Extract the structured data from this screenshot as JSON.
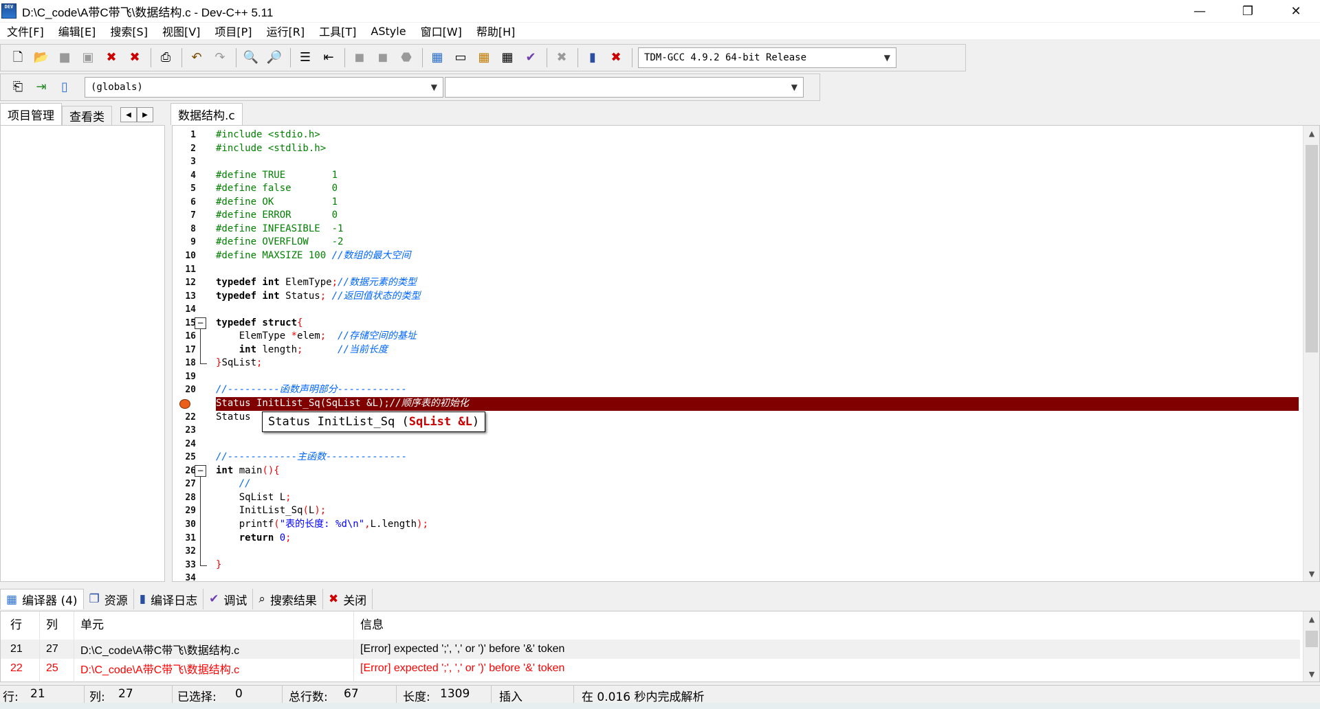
{
  "window": {
    "title": "D:\\C_code\\A带C带飞\\数据结构.c - Dev-C++ 5.11",
    "app_icon_label": "DEV",
    "minimize": "—",
    "restore": "❐",
    "close": "✕"
  },
  "menu": [
    "文件[F]",
    "编辑[E]",
    "搜索[S]",
    "视图[V]",
    "项目[P]",
    "运行[R]",
    "工具[T]",
    "AStyle",
    "窗口[W]",
    "帮助[H]"
  ],
  "toolbar": {
    "compiler_select": "TDM-GCC 4.9.2 64-bit Release",
    "scope_select": "(globals)",
    "function_select": ""
  },
  "left_panel": {
    "tabs": [
      "项目管理",
      "查看类"
    ],
    "nav_prev": "◀",
    "nav_next": "▶"
  },
  "editor": {
    "tab_label": "数据结构.c",
    "error_line": 21,
    "cursor": {
      "line": 21,
      "col": 27
    },
    "lines": [
      {
        "n": "1",
        "t": [
          [
            "pp",
            "#include <stdio.h>"
          ]
        ]
      },
      {
        "n": "2",
        "t": [
          [
            "pp",
            "#include <stdlib.h>"
          ]
        ]
      },
      {
        "n": "3",
        "t": []
      },
      {
        "n": "4",
        "t": [
          [
            "pp",
            "#define TRUE        1"
          ]
        ]
      },
      {
        "n": "5",
        "t": [
          [
            "pp",
            "#define false       0"
          ]
        ]
      },
      {
        "n": "6",
        "t": [
          [
            "pp",
            "#define OK          1"
          ]
        ]
      },
      {
        "n": "7",
        "t": [
          [
            "pp",
            "#define ERROR       0"
          ]
        ]
      },
      {
        "n": "8",
        "t": [
          [
            "pp",
            "#define INFEASIBLE  -1"
          ]
        ]
      },
      {
        "n": "9",
        "t": [
          [
            "pp",
            "#define OVERFLOW    -2"
          ]
        ]
      },
      {
        "n": "10",
        "t": [
          [
            "pp",
            "#define MAXSIZE 100 "
          ],
          [
            "cm",
            "//数组的最大空间"
          ]
        ]
      },
      {
        "n": "11",
        "t": []
      },
      {
        "n": "12",
        "t": [
          [
            "kw",
            "typedef int "
          ],
          [
            "",
            "ElemType"
          ],
          [
            "sym",
            ";"
          ],
          [
            "cm",
            "//数据元素的类型"
          ]
        ]
      },
      {
        "n": "13",
        "t": [
          [
            "kw",
            "typedef int "
          ],
          [
            "",
            "Status"
          ],
          [
            "sym",
            "; "
          ],
          [
            "cm",
            "//返回值状态的类型"
          ]
        ]
      },
      {
        "n": "14",
        "t": []
      },
      {
        "n": "15",
        "t": [
          [
            "kw",
            "typedef struct"
          ],
          [
            "sym",
            "{"
          ]
        ]
      },
      {
        "n": "16",
        "t": [
          [
            "",
            "    ElemType "
          ],
          [
            "sym",
            "*"
          ],
          [
            "",
            "elem"
          ],
          [
            "sym",
            ";  "
          ],
          [
            "cm",
            "//存储空间的基址"
          ]
        ]
      },
      {
        "n": "17",
        "t": [
          [
            "kw",
            "    int "
          ],
          [
            "",
            "length"
          ],
          [
            "sym",
            ";      "
          ],
          [
            "cm",
            "//当前长度"
          ]
        ]
      },
      {
        "n": "18",
        "t": [
          [
            "sym",
            "}"
          ],
          [
            "",
            "SqList"
          ],
          [
            "sym",
            ";"
          ]
        ]
      },
      {
        "n": "19",
        "t": []
      },
      {
        "n": "20",
        "t": [
          [
            "cm",
            "//---------函数声明部分------------"
          ]
        ]
      },
      {
        "n": "21",
        "t": [
          [
            "",
            "Status InitList_Sq(SqList &L);"
          ],
          [
            "cm",
            "//顺序表的初始化"
          ]
        ]
      },
      {
        "n": "22",
        "t": [
          [
            "",
            "Status                              "
          ],
          [
            "sym",
            ";"
          ]
        ]
      },
      {
        "n": "23",
        "t": []
      },
      {
        "n": "24",
        "t": []
      },
      {
        "n": "25",
        "t": [
          [
            "cm",
            "//------------主函数--------------"
          ]
        ]
      },
      {
        "n": "26",
        "t": [
          [
            "kw",
            "int "
          ],
          [
            "",
            "main"
          ],
          [
            "sym",
            "(){"
          ]
        ]
      },
      {
        "n": "27",
        "t": [
          [
            "cm",
            "    //"
          ]
        ]
      },
      {
        "n": "28",
        "t": [
          [
            "",
            "    SqList L"
          ],
          [
            "sym",
            ";"
          ]
        ]
      },
      {
        "n": "29",
        "t": [
          [
            "",
            "    InitList_Sq"
          ],
          [
            "sym",
            "("
          ],
          [
            "",
            "L"
          ],
          [
            "sym",
            ");"
          ]
        ]
      },
      {
        "n": "30",
        "t": [
          [
            "",
            "    printf"
          ],
          [
            "sym",
            "("
          ],
          [
            "str",
            "\"表的长度: %d\\n\""
          ],
          [
            "sym",
            ","
          ],
          [
            "",
            "L.length"
          ],
          [
            "sym",
            ");"
          ]
        ]
      },
      {
        "n": "31",
        "t": [
          [
            "kw",
            "    return "
          ],
          [
            "num",
            "0"
          ],
          [
            "sym",
            ";"
          ]
        ]
      },
      {
        "n": "32",
        "t": []
      },
      {
        "n": "33",
        "t": [
          [
            "sym",
            "}"
          ]
        ]
      },
      {
        "n": "34",
        "t": []
      }
    ],
    "tooltip": {
      "prefix": "Status InitList_Sq (",
      "param": "SqList &L",
      "suffix": ")"
    }
  },
  "bottom_panel": {
    "tabs": [
      {
        "icon": "grid-icon",
        "glyph": "▦",
        "label": "编译器 (4)"
      },
      {
        "icon": "resources-icon",
        "glyph": "❐",
        "label": "资源"
      },
      {
        "icon": "chart-icon",
        "glyph": "▮",
        "label": "编译日志"
      },
      {
        "icon": "check-icon",
        "glyph": "✔",
        "label": "调试"
      },
      {
        "icon": "search-icon",
        "glyph": "⌕",
        "label": "搜索结果"
      },
      {
        "icon": "close-icon",
        "glyph": "✖",
        "label": "关闭"
      }
    ],
    "columns": [
      "行",
      "列",
      "单元",
      "信息"
    ],
    "rows": [
      {
        "line": "21",
        "col": "27",
        "unit": "D:\\C_code\\A带C带飞\\数据结构.c",
        "msg": "[Error] expected ';', ',' or ')' before '&' token"
      },
      {
        "line": "22",
        "col": "25",
        "unit": "D:\\C_code\\A带C带飞\\数据结构.c",
        "msg": "[Error] expected ';', ',' or ')' before '&' token"
      }
    ]
  },
  "status": {
    "line_label": "行:",
    "line": "21",
    "col_label": "列:",
    "col": "27",
    "sel_label": "已选择:",
    "sel": "0",
    "total_label": "总行数:",
    "total": "67",
    "len_label": "长度:",
    "len": "1309",
    "mode": "插入",
    "parse": "在 0.016 秒内完成解析"
  }
}
